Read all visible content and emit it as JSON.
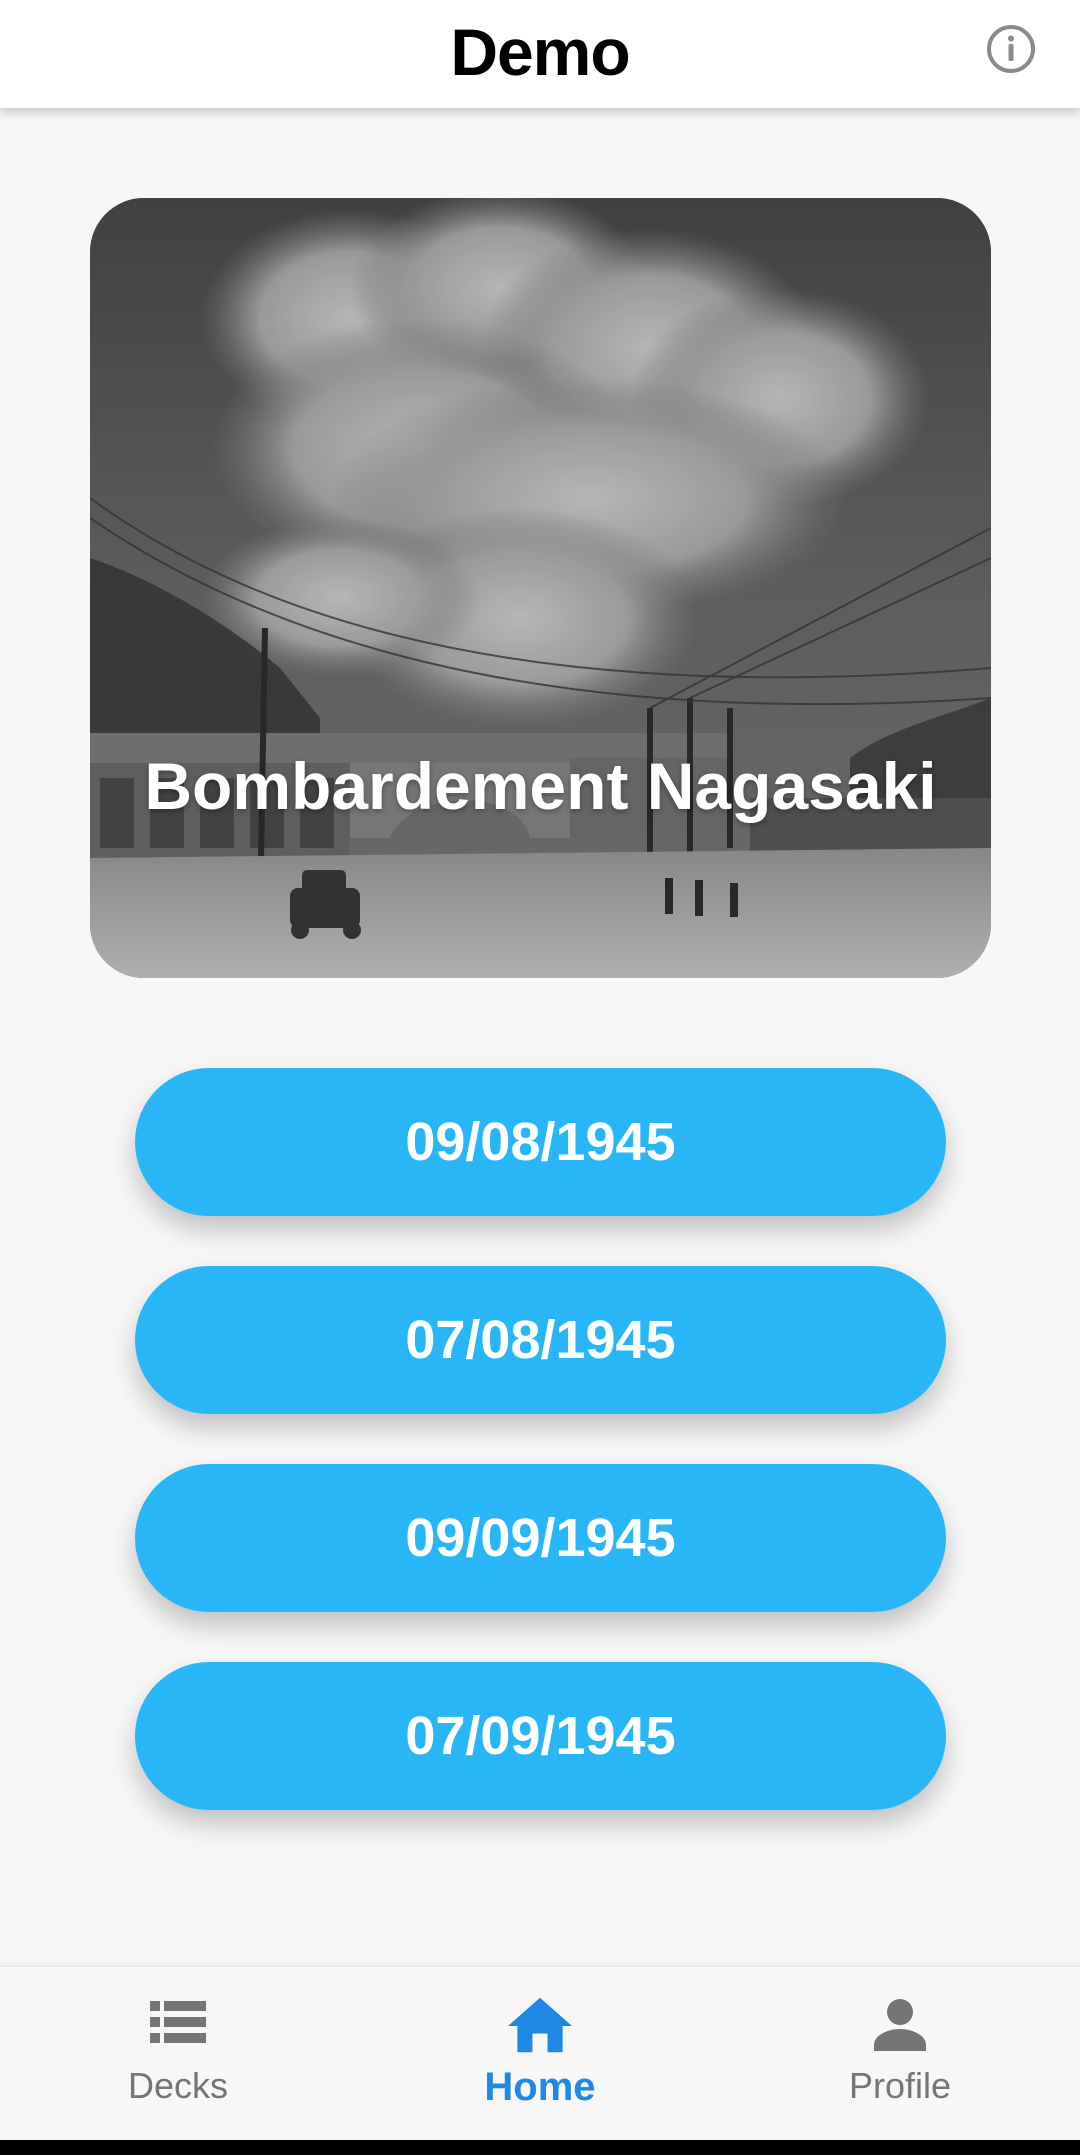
{
  "app_bar": {
    "title": "Demo",
    "info_icon": "info-icon"
  },
  "card": {
    "title": "Bombardement Nagasaki",
    "image": "black-and-white photo of a mushroom cloud over a street with a railway bridge, utility poles and a car"
  },
  "answers": [
    {
      "label": "09/08/1945"
    },
    {
      "label": "07/08/1945"
    },
    {
      "label": "09/09/1945"
    },
    {
      "label": "07/09/1945"
    }
  ],
  "bottom_nav": {
    "items": [
      {
        "label": "Decks",
        "icon": "list-icon",
        "active": false
      },
      {
        "label": "Home",
        "icon": "home-icon",
        "active": true
      },
      {
        "label": "Profile",
        "icon": "person-icon",
        "active": false
      }
    ]
  },
  "colors": {
    "accent": "#29b6f6",
    "nav_active": "#1e88e5",
    "nav_inactive": "#757575",
    "background": "#f7f7f7"
  }
}
